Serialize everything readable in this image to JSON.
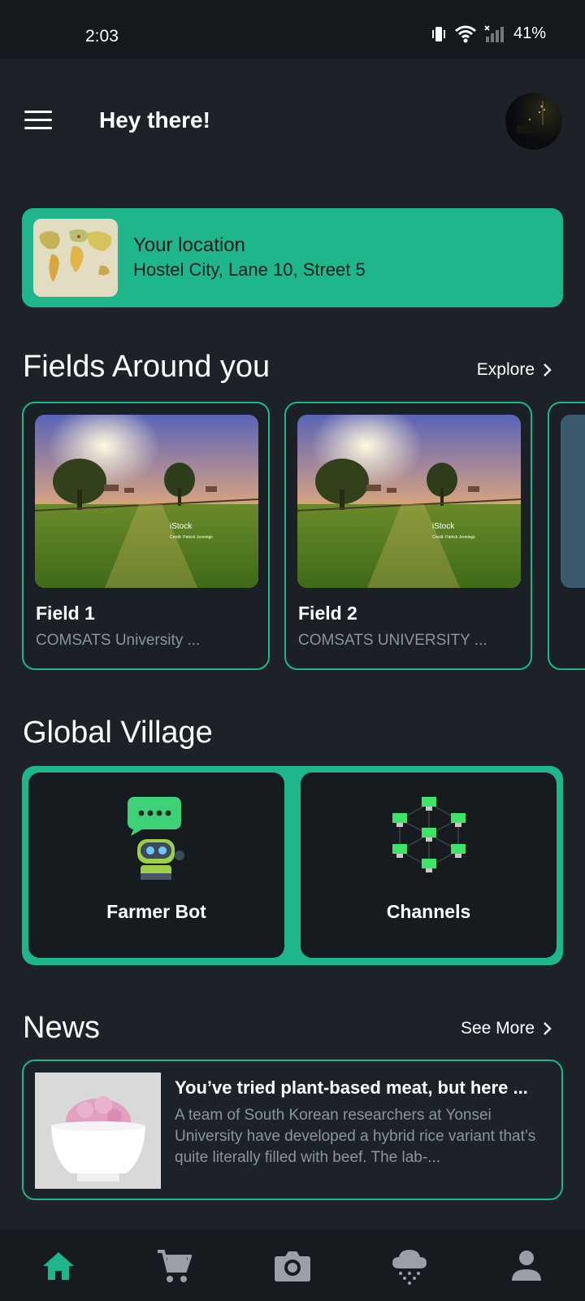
{
  "status_bar": {
    "time": "2:03",
    "battery": "41%",
    "icons": [
      "vibrate-icon",
      "wifi-icon",
      "signal-icon"
    ]
  },
  "header": {
    "greeting": "Hey there!",
    "menu_icon": "menu-icon",
    "avatar": "profile-avatar"
  },
  "location": {
    "title": "Your location",
    "address": "Hostel City, Lane 10, Street 5"
  },
  "fields_section": {
    "title": "Fields Around you",
    "link": "Explore",
    "items": [
      {
        "name": "Field 1",
        "location": "COMSATS University ...",
        "photo_watermark": "iStock",
        "photo_credit": "Credit: Patrick Jennings"
      },
      {
        "name": "Field 2",
        "location": "COMSATS UNIVERSITY ...",
        "photo_watermark": "iStock",
        "photo_credit": "Credit: Patrick Jennings"
      }
    ]
  },
  "global_village": {
    "title": "Global Village",
    "tiles": [
      {
        "label": "Farmer Bot",
        "icon": "chat-robot-icon"
      },
      {
        "label": "Channels",
        "icon": "network-nodes-icon"
      }
    ]
  },
  "news": {
    "title": "News",
    "link": "See More",
    "article": {
      "headline": "You’ve tried plant-based meat, but here ...",
      "body": "A team of South Korean researchers at Yonsei University have developed a hybrid rice variant  that’s quite literally filled with beef. The lab-..."
    }
  },
  "bottom_nav": {
    "items": [
      "home-icon",
      "cart-icon",
      "camera-icon",
      "weather-icon",
      "profile-icon"
    ],
    "active": "home-icon"
  },
  "colors": {
    "accent": "#1fb68c",
    "background": "#1c2228",
    "card_dark": "#161b20",
    "muted_text": "#8d9499",
    "inactive_icon": "#9aa0a5",
    "bot_green": "#3fd178"
  }
}
